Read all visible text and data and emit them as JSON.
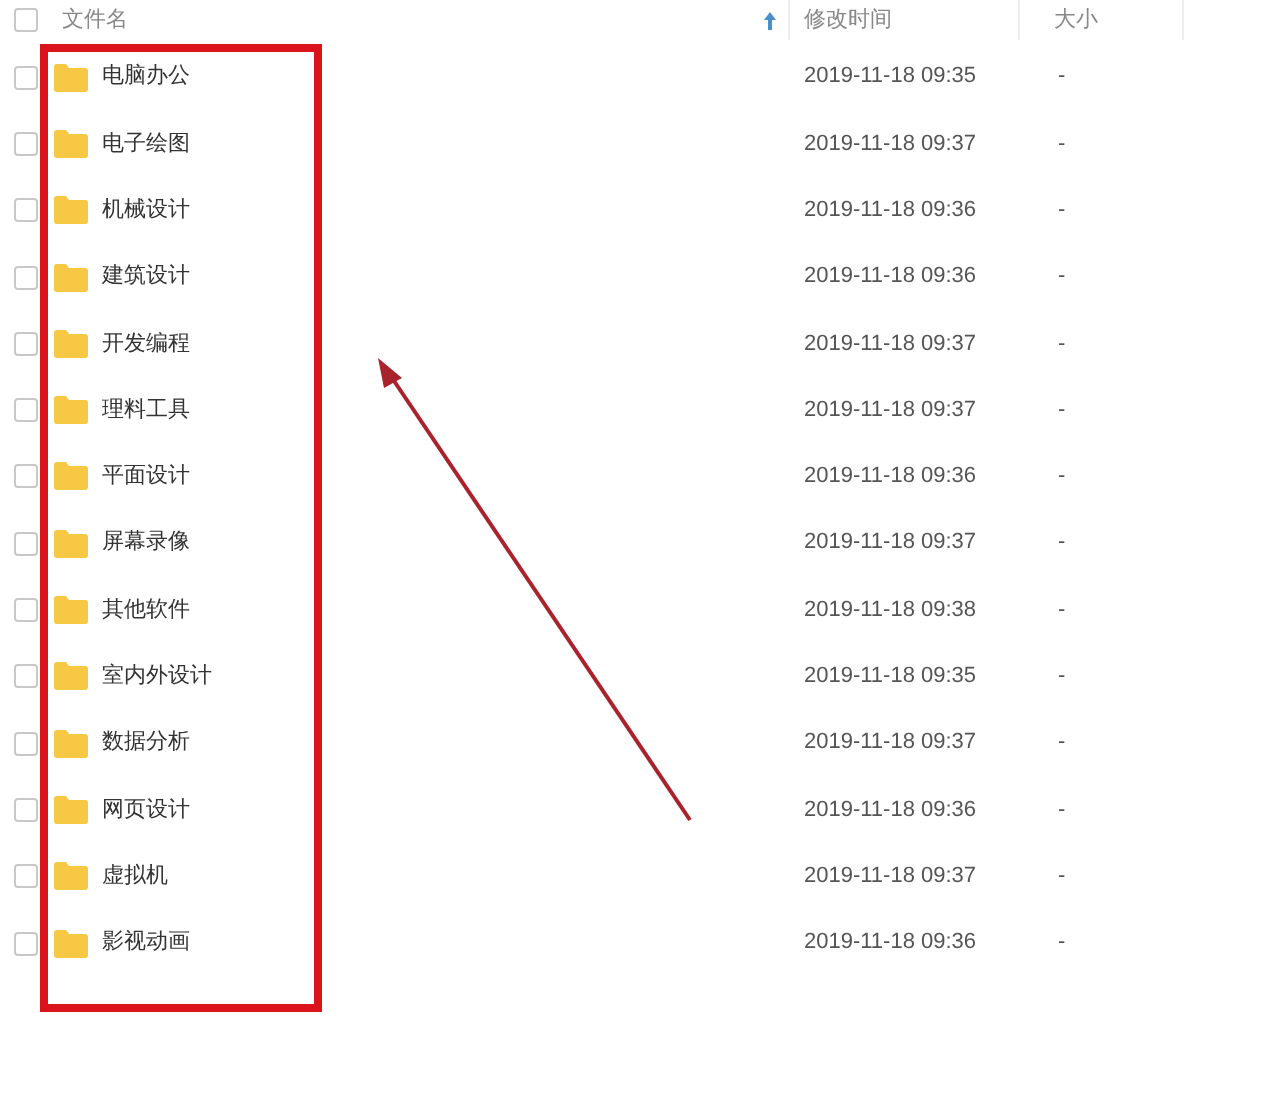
{
  "header": {
    "checkbox": {
      "checked": false
    },
    "columns": [
      {
        "label": "文件名",
        "sorted": true
      },
      {
        "label": "修改时间",
        "sorted": false
      },
      {
        "label": "大小",
        "sorted": false
      }
    ]
  },
  "rows": [
    {
      "name": "电脑办公",
      "modified": "2019-11-18 09:35",
      "size": "-",
      "checked": false
    },
    {
      "name": "电子绘图",
      "modified": "2019-11-18 09:37",
      "size": "-",
      "checked": false
    },
    {
      "name": "机械设计",
      "modified": "2019-11-18 09:36",
      "size": "-",
      "checked": false
    },
    {
      "name": "建筑设计",
      "modified": "2019-11-18 09:36",
      "size": "-",
      "checked": false
    },
    {
      "name": "开发编程",
      "modified": "2019-11-18 09:37",
      "size": "-",
      "checked": false
    },
    {
      "name": "理料工具",
      "modified": "2019-11-18 09:37",
      "size": "-",
      "checked": false
    },
    {
      "name": "平面设计",
      "modified": "2019-11-18 09:36",
      "size": "-",
      "checked": false
    },
    {
      "name": "屏幕录像",
      "modified": "2019-11-18 09:37",
      "size": "-",
      "checked": false
    },
    {
      "name": "其他软件",
      "modified": "2019-11-18 09:38",
      "size": "-",
      "checked": false
    },
    {
      "name": "室内外设计",
      "modified": "2019-11-18 09:35",
      "size": "-",
      "checked": false
    },
    {
      "name": "数据分析",
      "modified": "2019-11-18 09:37",
      "size": "-",
      "checked": false
    },
    {
      "name": "网页设计",
      "modified": "2019-11-18 09:36",
      "size": "-",
      "checked": false
    },
    {
      "name": "虚拟机",
      "modified": "2019-11-18 09:37",
      "size": "-",
      "checked": false
    },
    {
      "name": "影视动画",
      "modified": "2019-11-18 09:36",
      "size": "-",
      "checked": false
    }
  ]
}
